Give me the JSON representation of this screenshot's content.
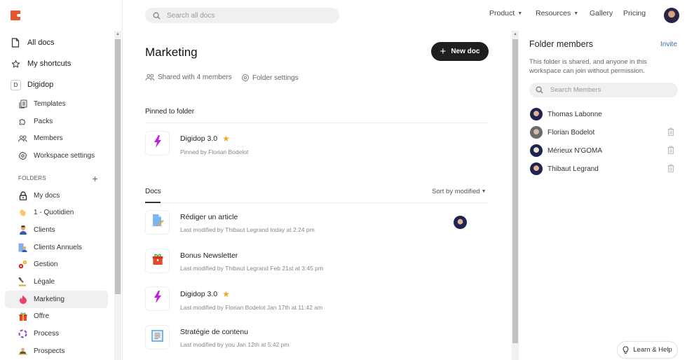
{
  "app": {
    "brand_color": "#e8552a"
  },
  "sidebar": {
    "top_items": [
      {
        "label": "All docs",
        "icon": "document-icon"
      },
      {
        "label": "My shortcuts",
        "icon": "star-icon"
      }
    ],
    "workspace": {
      "badge": "D",
      "label": "Digidop"
    },
    "workspace_items": [
      {
        "label": "Templates",
        "icon": "templates-icon"
      },
      {
        "label": "Packs",
        "icon": "puzzle-icon"
      },
      {
        "label": "Members",
        "icon": "members-icon"
      },
      {
        "label": "Workspace settings",
        "icon": "gear-icon"
      }
    ],
    "folders_header": "FOLDERS",
    "folders": [
      {
        "label": "My docs",
        "icon": "lock-icon"
      },
      {
        "label": "1 - Quotidien",
        "icon": "waving-hand-icon"
      },
      {
        "label": "Clients",
        "icon": "person-icon"
      },
      {
        "label": "Clients Annuels",
        "icon": "person-building-icon"
      },
      {
        "label": "Gestion",
        "icon": "gears-icon"
      },
      {
        "label": "Légale",
        "icon": "gavel-icon"
      },
      {
        "label": "Marketing",
        "icon": "flame-icon",
        "active": true
      },
      {
        "label": "Offre",
        "icon": "gift-icon"
      },
      {
        "label": "Process",
        "icon": "cycle-icon"
      },
      {
        "label": "Prospects",
        "icon": "prospect-icon"
      }
    ]
  },
  "topbar": {
    "search_placeholder": "Search all docs",
    "nav": [
      {
        "label": "Product",
        "dropdown": true
      },
      {
        "label": "Resources",
        "dropdown": true
      },
      {
        "label": "Gallery",
        "dropdown": false
      },
      {
        "label": "Pricing",
        "dropdown": false
      }
    ]
  },
  "main": {
    "title": "Marketing",
    "new_doc_label": "New doc",
    "shared_label": "Shared with 4 members",
    "folder_settings_label": "Folder settings",
    "pinned_header": "Pinned to folder",
    "pinned": [
      {
        "name": "Digidop 3.0",
        "starred": true,
        "sub": "Pinned by Florian Bodelot",
        "icon": "lightning-icon"
      }
    ],
    "docs_tab": "Docs",
    "sort_label": "Sort by modified",
    "docs": [
      {
        "name": "Rédiger un article",
        "starred": false,
        "sub": "Last modified by Thibaut Legrand today at 2:24 pm",
        "icon": "document-pencil-icon",
        "has_avatar": true
      },
      {
        "name": "Bonus Newsletter",
        "starred": false,
        "sub": "Last modified by Thibaut Legrand Feb 21st at 3:45 pm",
        "icon": "gift-icon"
      },
      {
        "name": "Digidop 3.0",
        "starred": true,
        "sub": "Last modified by Florian Bodelot Jan 17th at 11:42 am",
        "icon": "lightning-icon"
      },
      {
        "name": "Stratégie de contenu",
        "starred": false,
        "sub": "Last modified by you Jan 12th at 5:42 pm",
        "icon": "text-document-icon"
      }
    ]
  },
  "right_panel": {
    "title": "Folder members",
    "invite_label": "Invite",
    "description": "This folder is shared, and anyone in this workspace can join without permission.",
    "search_placeholder": "Search Members",
    "members": [
      {
        "name": "Thomas Labonne",
        "removable": false
      },
      {
        "name": "Florian Bodelot",
        "removable": true
      },
      {
        "name": "Mérieux N'GOMA",
        "removable": true
      },
      {
        "name": "Thibaut Legrand",
        "removable": true
      }
    ]
  },
  "help": {
    "label": "Learn & Help"
  }
}
